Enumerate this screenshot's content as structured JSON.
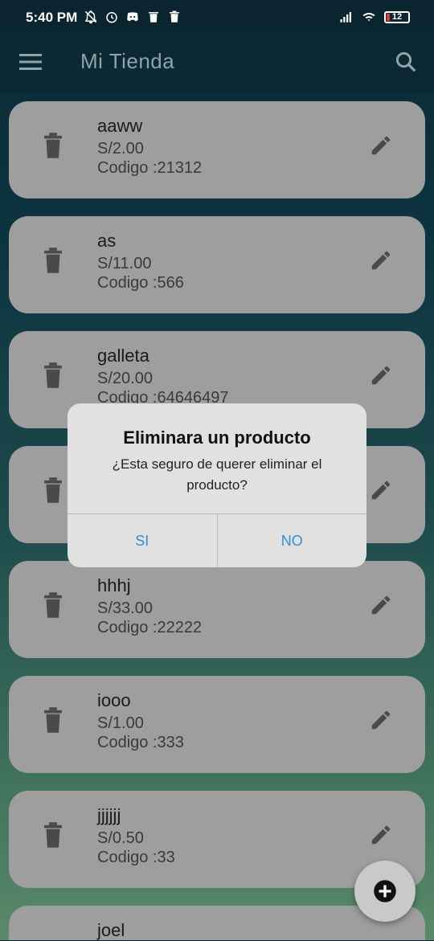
{
  "status_bar": {
    "time": "5:40 PM",
    "left_icons": [
      "bell-off-icon",
      "alarm-icon",
      "discord-icon",
      "trash-notif-icon",
      "delete-icon"
    ],
    "right_icons": [
      "signal-icon",
      "wifi-icon"
    ],
    "battery_level": "12",
    "battery_color": "#e53935"
  },
  "app_bar": {
    "title": "Mi Tienda",
    "menu_icon": "menu-icon",
    "search_icon": "search-icon"
  },
  "products": [
    {
      "name": "aaww",
      "price": "S/2.00",
      "code": "Codigo :21312"
    },
    {
      "name": "as",
      "price": "S/11.00",
      "code": "Codigo :566"
    },
    {
      "name": "galleta",
      "price": "S/20.00",
      "code": "Codigo :64646497"
    },
    {
      "name": "",
      "price": "",
      "code": ""
    },
    {
      "name": "hhhj",
      "price": "S/33.00",
      "code": "Codigo :22222"
    },
    {
      "name": "iooo",
      "price": "S/1.00",
      "code": "Codigo :333"
    },
    {
      "name": "jjjjjj",
      "price": "S/0.50",
      "code": "Codigo :33"
    },
    {
      "name": "joel",
      "price": "",
      "code": ""
    }
  ],
  "dialog": {
    "title": "Eliminara un producto",
    "message": "¿Esta seguro de querer eliminar el producto?",
    "yes_label": "SI",
    "no_label": "NO",
    "button_color": "#2f8fdc"
  },
  "fab": {
    "icon": "add-circle-icon"
  },
  "colors": {
    "card": "#9e9e9e",
    "icon": "#4a4a4a",
    "app_bar": "#0b2833"
  }
}
